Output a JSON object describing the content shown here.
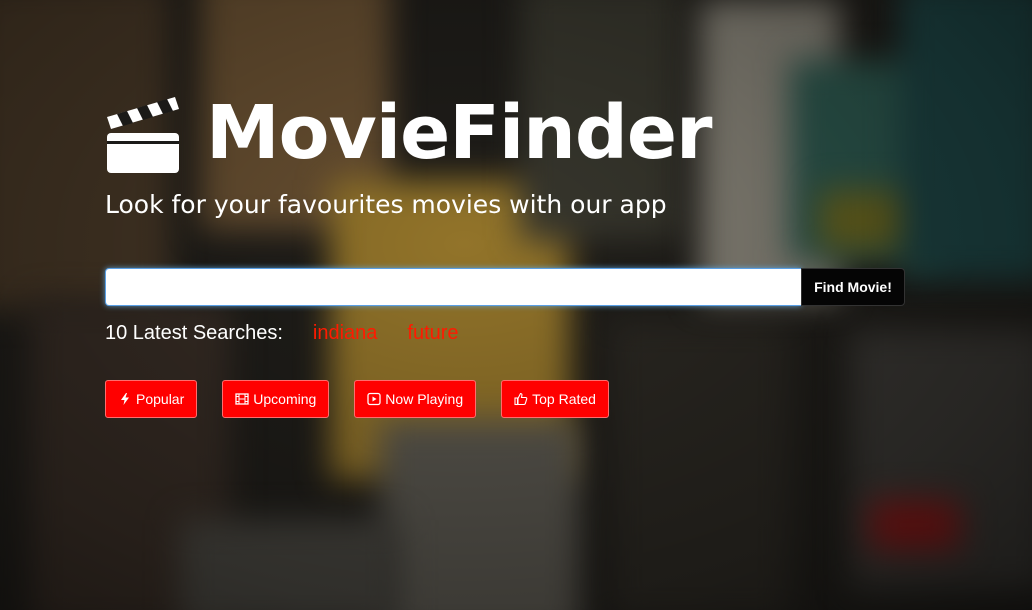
{
  "brand": {
    "name": "MovieFinder",
    "tagline": "Look for your favourites movies with our app",
    "icon": "clapperboard-icon"
  },
  "search": {
    "value": "",
    "placeholder": "",
    "button_label": "Find Movie!"
  },
  "latest_searches": {
    "label": "10 Latest Searches:",
    "items": [
      "indiana",
      "future"
    ]
  },
  "categories": [
    {
      "label": "Popular",
      "icon": "bolt-icon"
    },
    {
      "label": "Upcoming",
      "icon": "film-icon"
    },
    {
      "label": "Now Playing",
      "icon": "play-icon"
    },
    {
      "label": "Top Rated",
      "icon": "thumbs-up-icon"
    }
  ],
  "colors": {
    "accent": "#ff0000",
    "link": "#ff1a00",
    "text": "#ffffff",
    "search_button_bg": "#050505"
  }
}
